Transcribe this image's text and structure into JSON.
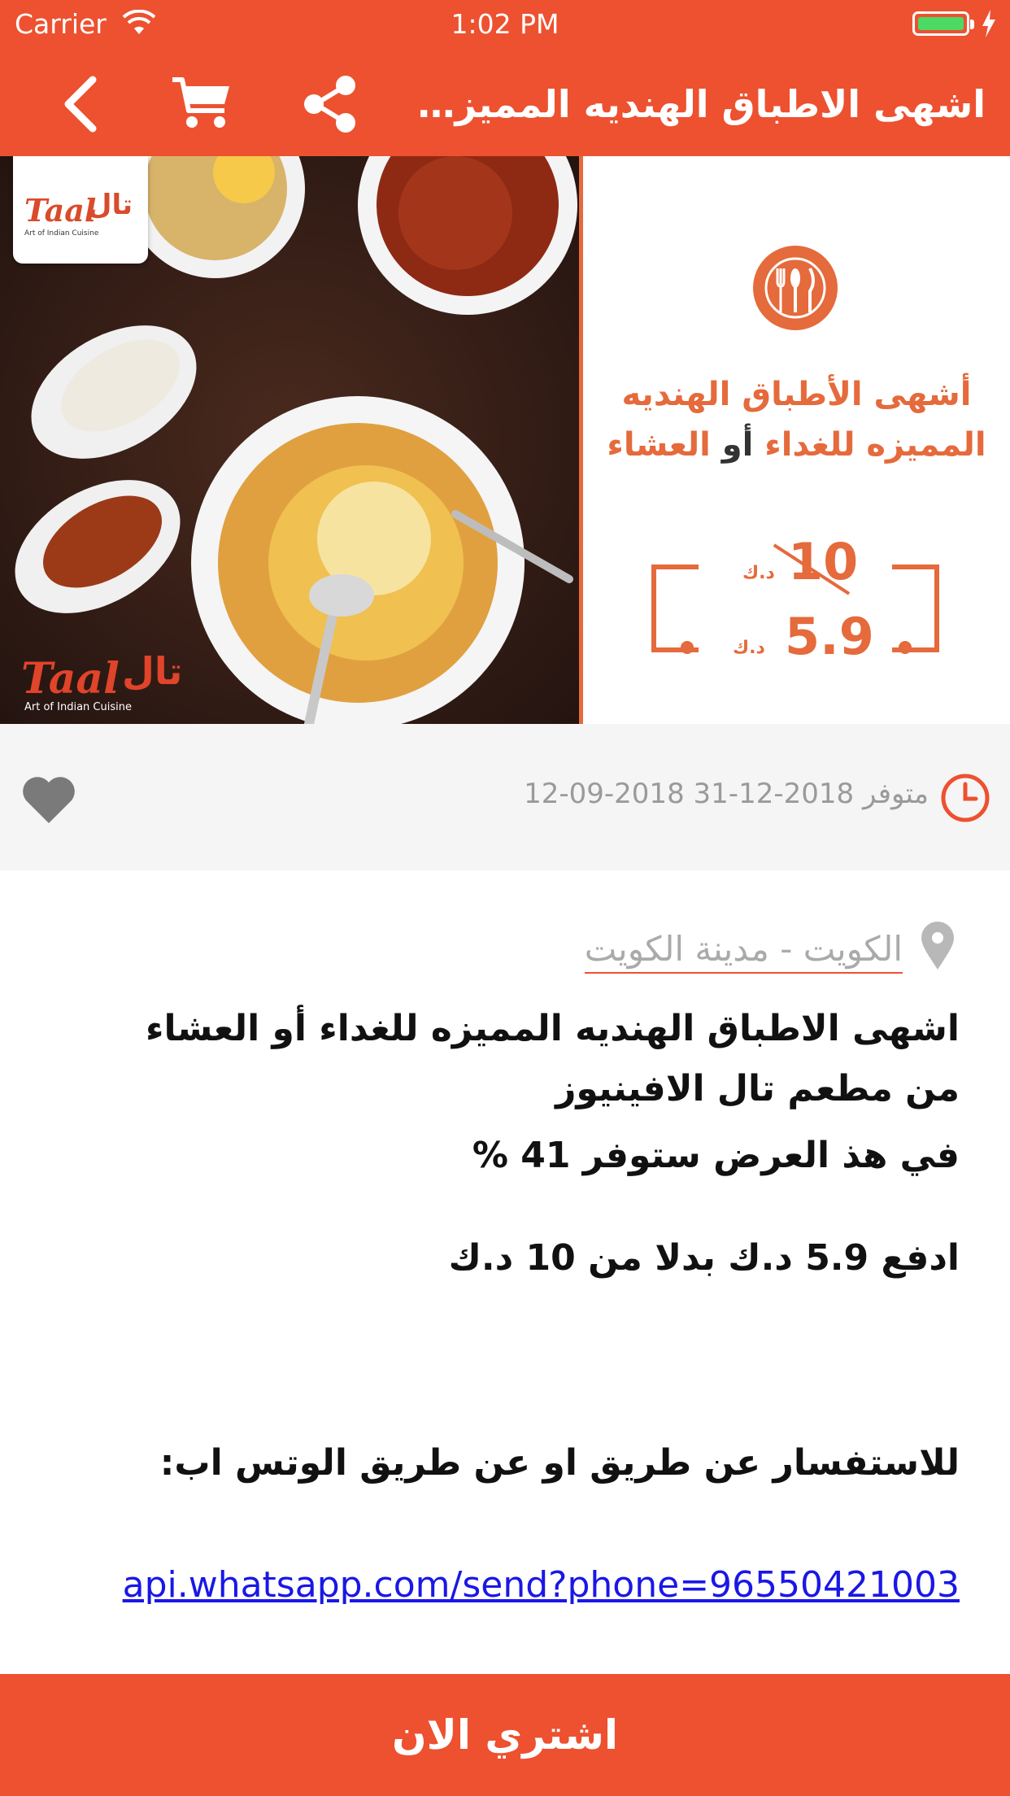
{
  "status_bar": {
    "carrier": "Carrier",
    "time": "1:02 PM"
  },
  "nav": {
    "title": "اشهى الاطباق الهنديه المميزه للغداء أو العشاء",
    "back_icon": "chevron-left-icon",
    "cart_icon": "cart-icon",
    "share_icon": "share-icon"
  },
  "hero": {
    "logo_text": "Taal",
    "logo_text_arabic": "تال",
    "logo_subtitle": "Art of Indian Cuisine",
    "heading_line1": "أشهى الأطباق الهنديه",
    "heading_line2_a": "المميزه للغداء ",
    "heading_line2_b": "أو",
    "heading_line2_c": " العشاء",
    "old_price": "10",
    "old_price_unit": "د.ك",
    "new_price": "5.9",
    "new_price_unit": "د.ك",
    "accent_color": "#E56A3C"
  },
  "info_bar": {
    "availability": "متوفر 2018-12-31 2018-09-12",
    "clock_icon": "clock-icon",
    "favorite_icon": "heart-icon"
  },
  "details": {
    "location": "الكويت - مدينة الكويت",
    "description_line1": "اشهى الاطباق الهنديه المميزه للغداء أو العشاء  من مطعم تال الافينيوز",
    "description_line2": "في هذ العرض ستوفر 41 %",
    "description_line3": "ادفع 5.9 د.ك بدلا من 10 د.ك",
    "inquiry": "للاستفسار عن طريق او عن طريق الوتس اب:",
    "whatsapp_link": "api.whatsapp.com/send?phone=96550421003"
  },
  "buy_button": {
    "label": "اشتري الان",
    "color": "#ED5130"
  }
}
